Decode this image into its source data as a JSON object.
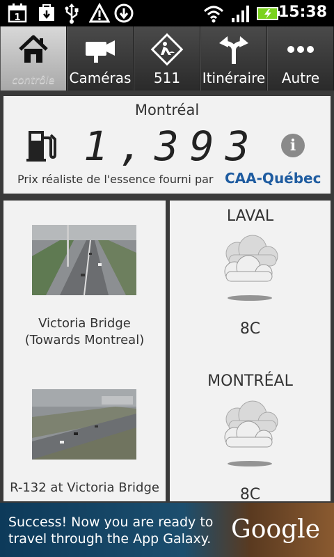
{
  "status_bar": {
    "time": "15:38",
    "icons": [
      "calendar-icon",
      "download-icon",
      "usb-icon",
      "warning-icon",
      "download-progress-icon",
      "wifi-icon",
      "signal-icon",
      "battery-charging-icon"
    ],
    "calendar_day": "1"
  },
  "tabs": [
    {
      "label": "contrôle",
      "icon": "home-icon",
      "active": true
    },
    {
      "label": "Caméras",
      "icon": "camera-icon",
      "active": false
    },
    {
      "label": "511",
      "icon": "roadwork-sign-icon",
      "active": false
    },
    {
      "label": "Itinéraire",
      "icon": "fork-arrow-icon",
      "active": false
    },
    {
      "label": "Autre",
      "icon": "more-dots-icon",
      "active": false
    }
  ],
  "gas": {
    "city": "Montréal",
    "price": "1,393",
    "credit": "Prix réaliste de l'essence fourni par",
    "provider": "CAA-Québec"
  },
  "cameras": [
    {
      "caption_line1": "Victoria Bridge",
      "caption_line2": "(Towards Montreal)"
    },
    {
      "caption_line1": "R-132 at Victoria Bridge",
      "caption_line2": ""
    }
  ],
  "weather": [
    {
      "city": "LAVAL",
      "temp": "8C",
      "condition_icon": "cloudy-icon"
    },
    {
      "city": "MONTRÉAL",
      "temp": "8C",
      "condition_icon": "cloudy-icon"
    }
  ],
  "ad": {
    "text": "Success! Now you are ready to travel through the App Galaxy.",
    "brand": "Google"
  },
  "colors": {
    "provider_blue": "#1f5ca0",
    "card_bg": "#f2f2f2",
    "page_bg": "#3a3a3a"
  }
}
